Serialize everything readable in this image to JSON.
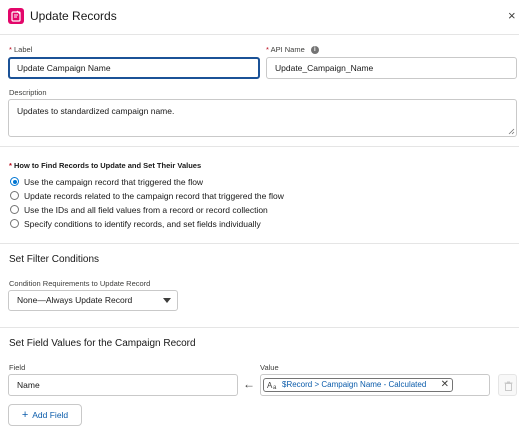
{
  "header": {
    "title": "Update Records",
    "close_label": "×"
  },
  "form": {
    "label_label": "Label",
    "label_value": "Update Campaign Name",
    "api_name_label": "API Name",
    "api_name_value": "Update_Campaign_Name",
    "description_label": "Description",
    "description_value": "Updates to standardized campaign name."
  },
  "find_records": {
    "title": "How to Find Records to Update and Set Their Values",
    "options": [
      "Use the campaign record that triggered the flow",
      "Update records related to the campaign record that triggered the flow",
      "Use the IDs and all field values from a record or record collection",
      "Specify conditions to identify records, and set fields individually"
    ],
    "selected_index": 0
  },
  "filter": {
    "title": "Set Filter Conditions",
    "condition_label": "Condition Requirements to Update Record",
    "condition_value": "None—Always Update Record"
  },
  "field_values": {
    "title": "Set Field Values for the Campaign Record",
    "field_label": "Field",
    "value_label": "Value",
    "rows": [
      {
        "field": "Name",
        "value": "$Record > Campaign Name - Calculated"
      }
    ],
    "add_field_label": "Add Field"
  }
}
